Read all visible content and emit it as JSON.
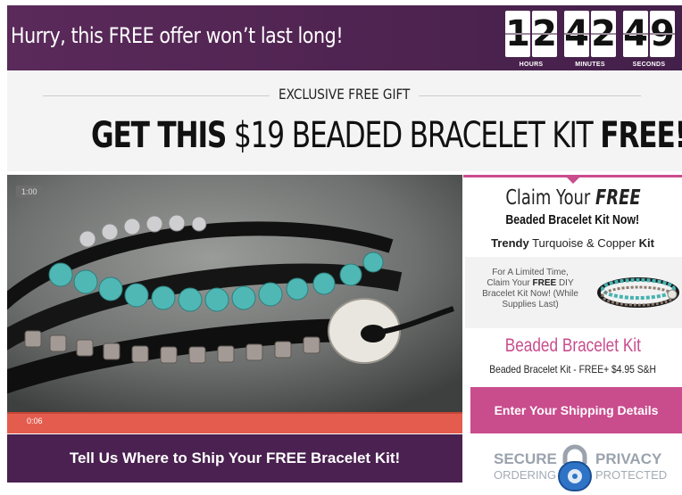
{
  "banner": {
    "message": "Hurry, this FREE offer won’t last long!",
    "timer": {
      "hours": [
        "1",
        "2"
      ],
      "minutes": [
        "4",
        "2"
      ],
      "seconds": [
        "4",
        "9"
      ],
      "hours_label": "HOURS",
      "minutes_label": "MINUTES",
      "seconds_label": "SECONDS"
    }
  },
  "headline": {
    "eyebrow": "EXCLUSIVE FREE GIFT",
    "part1": "GET THIS",
    "part2": " $19 BEADED BRACELET KIT ",
    "part3": "FREE!"
  },
  "video": {
    "duration_badge": "1:00",
    "current_time": "0:06"
  },
  "ship_cta": "Tell Us Where to Ship Your FREE Bracelet Kit!",
  "sidebar": {
    "claim_a": "Claim Your ",
    "claim_b": "FREE",
    "claim_line2": "Beaded Bracelet Kit Now!",
    "trendy_bold": "Trendy",
    "trendy_rest": " Turquoise & Copper ",
    "trendy_kit": "Kit",
    "promo_line1": "For A Limited Time,",
    "promo_line2a": "Claim Your ",
    "promo_line2b": "FREE",
    "promo_line2c": " DIY",
    "promo_line3": "Bracelet Kit Now! (While",
    "promo_line4": "Supplies Last)",
    "product_title": "Beaded Bracelet Kit",
    "product_sub": "Beaded Bracelet Kit - FREE+ $4.95 S&H",
    "enter_button": "Enter Your Shipping Details",
    "secure_top": "SECURE",
    "secure_bottom": "ORDERING",
    "privacy_top": "PRIVACY",
    "privacy_bottom": "PROTECTED"
  },
  "colors": {
    "banner": "#4e2350",
    "accent_pink": "#c94c8d",
    "progress": "#e45c4e"
  }
}
